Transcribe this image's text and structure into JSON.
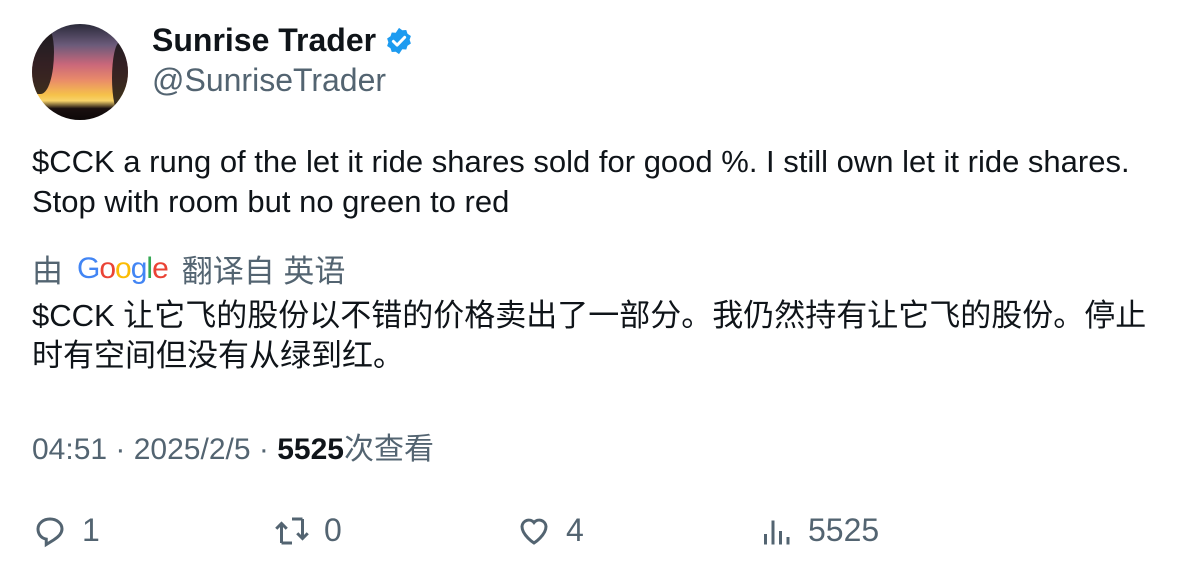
{
  "author": {
    "name": "Sunrise Trader",
    "handle": "@SunriseTrader",
    "verified": true,
    "verified_color": "#1d9bf0"
  },
  "tweet": {
    "text": "$CCK a rung of  the let it ride shares sold for good %.  I still own let it ride shares. Stop with room but no green to red"
  },
  "translation": {
    "prefix": "由",
    "provider": "Google",
    "suffix": "翻译自 英语",
    "text": "$CCK 让它飞的股份以不错的价格卖出了一部分。我仍然持有让它飞的股份。停止时有空间但没有从绿到红。"
  },
  "meta": {
    "time": "04:51",
    "sep": " · ",
    "date": "2025/2/5",
    "views": "5525",
    "views_label": "次查看"
  },
  "actions": {
    "replies": "1",
    "retweets": "0",
    "likes": "4",
    "views": "5525"
  }
}
